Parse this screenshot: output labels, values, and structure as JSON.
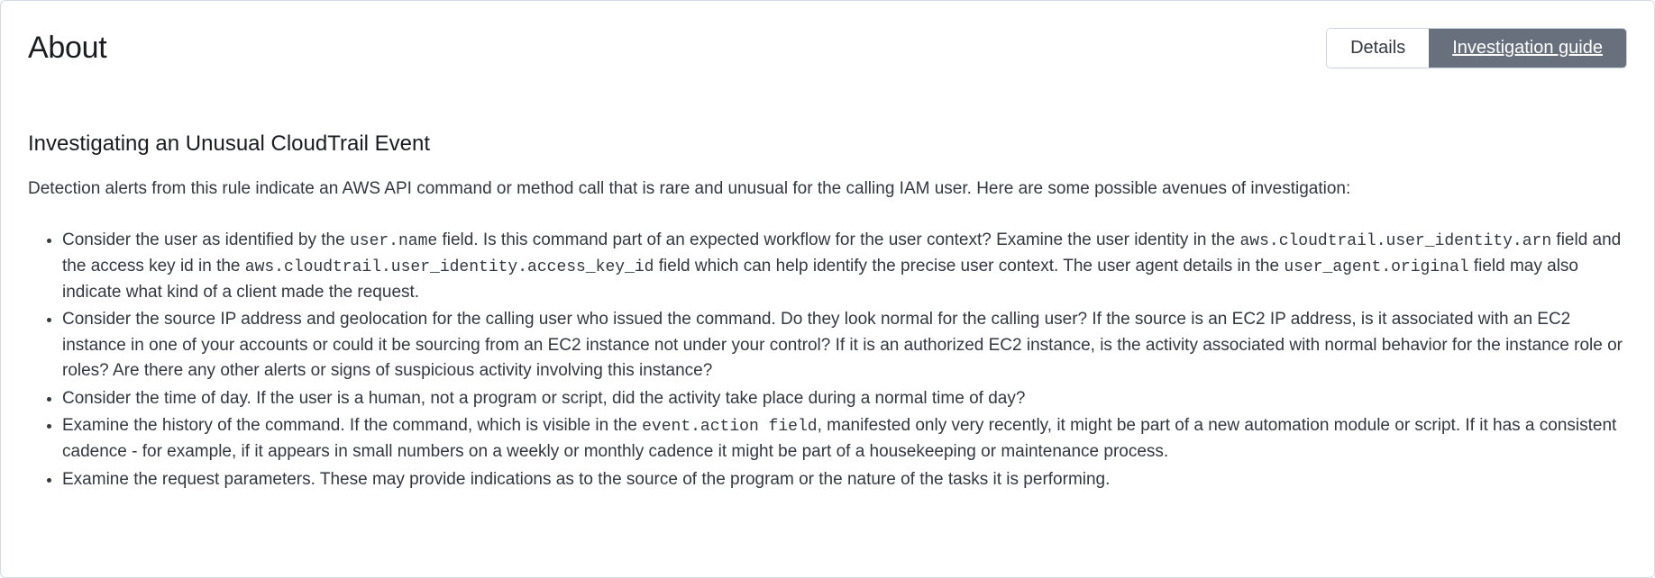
{
  "panel": {
    "title": "About"
  },
  "tabs": {
    "details": "Details",
    "guide": "Investigation guide"
  },
  "guide": {
    "heading": "Investigating an Unusual CloudTrail Event",
    "intro": "Detection alerts from this rule indicate an AWS API command or method call that is rare and unusual for the calling IAM user. Here are some possible avenues of investigation:",
    "bullets": {
      "b1": {
        "t1": "Consider the user as identified by the ",
        "c1": "user.name",
        "t2": " field. Is this command part of an expected workflow for the user context? Examine the user identity in the ",
        "c2": "aws.cloudtrail.user_identity.arn",
        "t3": " field and the access key id in the ",
        "c3": "aws.cloudtrail.user_identity.access_key_id",
        "t4": " field which can help identify the precise user context. The user agent details in the ",
        "c4": "user_agent.original",
        "t5": " field may also indicate what kind of a client made the request."
      },
      "b2": "Consider the source IP address and geolocation for the calling user who issued the command. Do they look normal for the calling user? If the source is an EC2 IP address, is it associated with an EC2 instance in one of your accounts or could it be sourcing from an EC2 instance not under your control? If it is an authorized EC2 instance, is the activity associated with normal behavior for the instance role or roles? Are there any other alerts or signs of suspicious activity involving this instance?",
      "b3": "Consider the time of day. If the user is a human, not a program or script, did the activity take place during a normal time of day?",
      "b4": {
        "t1": "Examine the history of the command. If the command, which is visible in the ",
        "c1": "event.action field",
        "t2": ", manifested only very recently, it might be part of a new automation module or script. If it has a consistent cadence - for example, if it appears in small numbers on a weekly or monthly cadence it might be part of a housekeeping or maintenance process."
      },
      "b5": "Examine the request parameters. These may provide indications as to the source of the program or the nature of the tasks it is performing."
    }
  }
}
